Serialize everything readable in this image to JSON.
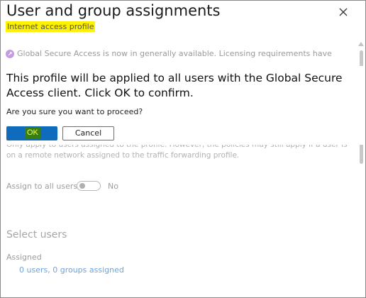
{
  "panel": {
    "title": "User and group assignments",
    "subtitle": "Internet access profile",
    "close_icon": "close-icon"
  },
  "banner": {
    "icon": "rocket-icon",
    "text": "Global Secure Access is now in generally available. Licensing requirements have"
  },
  "background_text": {
    "line1": "Only apply to users assigned to the profile. However, the policies may still apply if a user is",
    "line2": "on a remote network assigned to the traffic forwarding profile."
  },
  "assign_all": {
    "label": "Assign to all users",
    "state": "No",
    "on": false
  },
  "select_users": {
    "title": "Select users",
    "assigned_label": "Assigned",
    "assigned_link": "0 users, 0 groups assigned"
  },
  "dialog": {
    "title": "This profile will be applied to all users with the Global Secure Access client. Click OK to confirm.",
    "question": "Are you sure you want to proceed?",
    "ok_label": "OK",
    "cancel_label": "Cancel"
  },
  "colors": {
    "accent": "#0f6cbd",
    "highlight": "#fff200",
    "link": "#6fa3d8"
  }
}
